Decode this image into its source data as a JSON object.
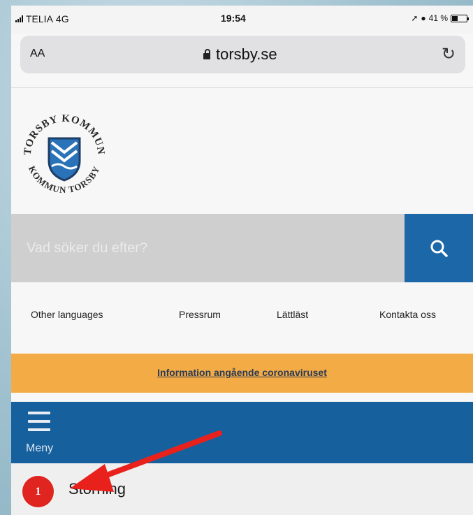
{
  "status_bar": {
    "carrier": "TELIA",
    "network": "4G",
    "time": "19:54",
    "battery": "41 %"
  },
  "browser": {
    "text_size_label": "AA",
    "url": "torsby.se",
    "reload_icon": "reload-icon"
  },
  "logo": {
    "top_text": "TORSBY KOMMUN",
    "bottom_text": "KOMMUN TORSBY"
  },
  "search": {
    "placeholder": "Vad söker du efter?",
    "button_icon": "search-icon"
  },
  "links": [
    {
      "label": "Other languages"
    },
    {
      "label": "Pressrum"
    },
    {
      "label": "Lättläst"
    },
    {
      "label": "Kontakta oss"
    }
  ],
  "banner": {
    "text": "Information angående coronaviruset"
  },
  "menu": {
    "label": "Meny",
    "icon": "hamburger-icon"
  },
  "storning": {
    "label": "Störning"
  },
  "annotation": {
    "badge_number": "1"
  },
  "colors": {
    "header_blue": "#1b67a8",
    "banner_orange": "#f3ab46",
    "badge_red": "#e0241f",
    "arrow_red": "#e8211c"
  }
}
